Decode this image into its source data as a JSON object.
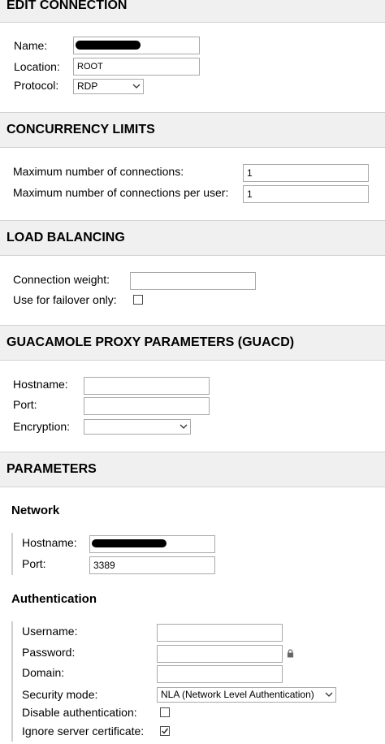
{
  "sections": {
    "edit_connection": "EDIT CONNECTION",
    "concurrency": "CONCURRENCY LIMITS",
    "load_balancing": "LOAD BALANCING",
    "guacd": "GUACAMOLE PROXY PARAMETERS (GUACD)",
    "parameters": "PARAMETERS"
  },
  "edit": {
    "name_label": "Name:",
    "name_value": "",
    "location_label": "Location:",
    "location_value": "ROOT",
    "protocol_label": "Protocol:",
    "protocol_value": "RDP"
  },
  "concurrency": {
    "max_conn_label": "Maximum number of connections:",
    "max_conn_value": "1",
    "max_per_user_label": "Maximum number of connections per user:",
    "max_per_user_value": "1"
  },
  "load_balancing": {
    "weight_label": "Connection weight:",
    "weight_value": "",
    "failover_label": "Use for failover only:",
    "failover_checked": false
  },
  "guacd": {
    "hostname_label": "Hostname:",
    "hostname_value": "",
    "port_label": "Port:",
    "port_value": "",
    "encryption_label": "Encryption:",
    "encryption_value": ""
  },
  "network": {
    "title": "Network",
    "hostname_label": "Hostname:",
    "hostname_value": "",
    "port_label": "Port:",
    "port_value": "3389"
  },
  "authentication": {
    "title": "Authentication",
    "username_label": "Username:",
    "username_value": "",
    "password_label": "Password:",
    "password_value": "",
    "domain_label": "Domain:",
    "domain_value": "",
    "security_mode_label": "Security mode:",
    "security_mode_value": "NLA (Network Level Authentication)",
    "disable_auth_label": "Disable authentication:",
    "disable_auth_checked": false,
    "ignore_cert_label": "Ignore server certificate:",
    "ignore_cert_checked": true
  }
}
